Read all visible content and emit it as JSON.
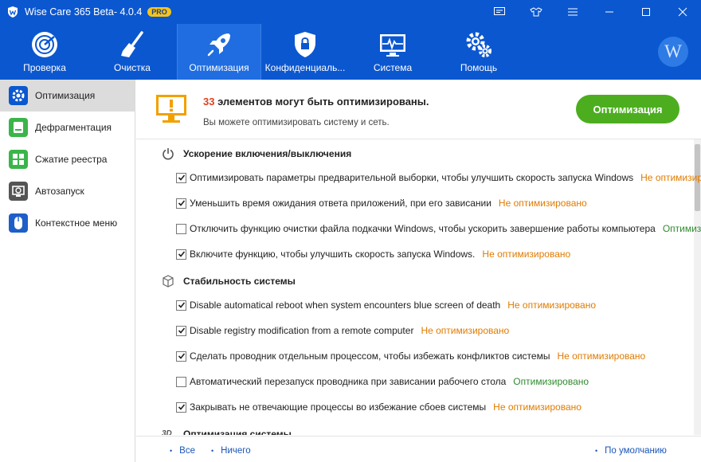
{
  "app": {
    "title": "Wise Care 365 Beta- 4.0.4",
    "badge": "PRO"
  },
  "nav": [
    {
      "label": "Проверка",
      "icon": "radar-icon"
    },
    {
      "label": "Очистка",
      "icon": "broom-icon"
    },
    {
      "label": "Оптимизация",
      "icon": "rocket-icon",
      "active": true
    },
    {
      "label": "Конфиденциаль...",
      "icon": "shield-icon"
    },
    {
      "label": "Система",
      "icon": "monitor-pulse-icon"
    },
    {
      "label": "Помощь",
      "icon": "gears-icon"
    }
  ],
  "avatar_letter": "W",
  "sidebar": [
    {
      "label": "Оптимизация",
      "icon": "gear-icon",
      "color": "#0b57d0",
      "active": true
    },
    {
      "label": "Дефрагментация",
      "icon": "disk-icon",
      "color": "#3bb54a"
    },
    {
      "label": "Сжатие реестра",
      "icon": "registry-icon",
      "color": "#3bb54a"
    },
    {
      "label": "Автозапуск",
      "icon": "startup-icon",
      "color": "#555555"
    },
    {
      "label": "Контекстное меню",
      "icon": "mouse-icon",
      "color": "#1e5fc7"
    }
  ],
  "header": {
    "count": "33",
    "headline_rest": " элементов могут быть оптимизированы.",
    "subline": "Вы можете оптимизировать систему и сеть.",
    "button": "Оптимизация"
  },
  "sections": [
    {
      "title": "Ускорение включения/выключения",
      "icon": "power-icon",
      "items": [
        {
          "text": "Оптимизировать параметры предварительной выборки, чтобы улучшить скорость запуска Windows",
          "checked": true,
          "status": "Не оптимизировано",
          "state": "warn"
        },
        {
          "text": "Уменьшить время ожидания ответа приложений, при его зависании",
          "checked": true,
          "status": "Не оптимизировано",
          "state": "warn"
        },
        {
          "text": "Отключить функцию очистки файла подкачки Windows, чтобы ускорить завершение работы компьютера",
          "checked": false,
          "status": "Оптимизиро...",
          "state": "ok"
        },
        {
          "text": "Включите функцию, чтобы улучшить скорость запуска Windows.",
          "checked": true,
          "status": "Не оптимизировано",
          "state": "warn"
        }
      ]
    },
    {
      "title": "Стабильность системы",
      "icon": "cube-icon",
      "items": [
        {
          "text": "Disable automatical reboot when system encounters blue screen of death",
          "checked": true,
          "status": "Не оптимизировано",
          "state": "warn"
        },
        {
          "text": "Disable registry modification from a remote computer",
          "checked": true,
          "status": "Не оптимизировано",
          "state": "warn"
        },
        {
          "text": "Сделать проводник отдельным процессом, чтобы избежать конфликтов системы",
          "checked": true,
          "status": "Не оптимизировано",
          "state": "warn"
        },
        {
          "text": "Автоматический перезапуск проводника при зависании рабочего стола",
          "checked": false,
          "status": "Оптимизировано",
          "state": "ok"
        },
        {
          "text": "Закрывать не отвечающие процессы во избежание сбоев системы",
          "checked": true,
          "status": "Не оптимизировано",
          "state": "warn"
        }
      ]
    },
    {
      "title": "Оптимизация системы",
      "icon": "3d-icon",
      "items": []
    }
  ],
  "footer": {
    "all": "Все",
    "none": "Ничего",
    "default": "По умолчанию"
  }
}
